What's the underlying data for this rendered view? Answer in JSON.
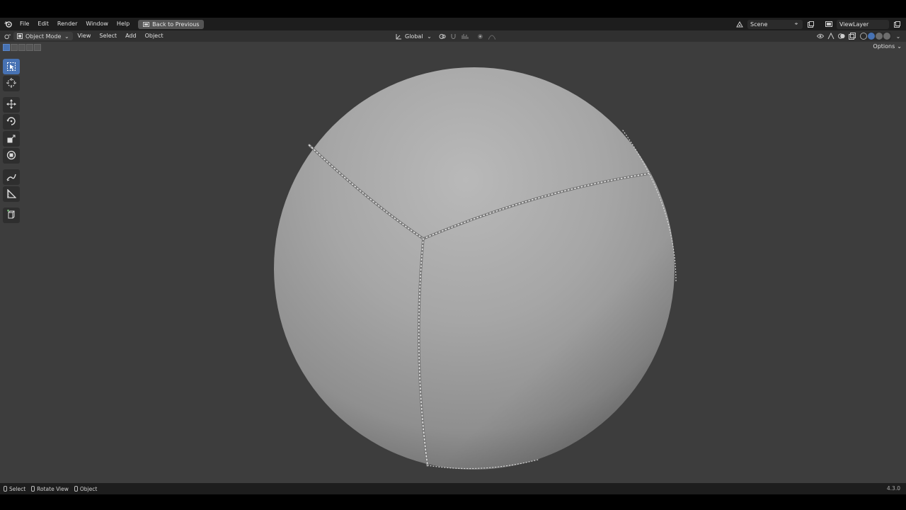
{
  "menubar": {
    "items": [
      "File",
      "Edit",
      "Render",
      "Window",
      "Help"
    ],
    "back_button": "Back to Previous",
    "scene": "Scene",
    "view_layer": "ViewLayer"
  },
  "viewport_header": {
    "mode": "Object Mode",
    "menus": [
      "View",
      "Select",
      "Add",
      "Object"
    ],
    "transform_orientation": "Global",
    "options": "Options"
  },
  "statusbar": {
    "items": [
      "Select",
      "Rotate View",
      "Object"
    ],
    "version": "4.3.0"
  },
  "colors": {
    "accent": "#4772b3",
    "viewport_bg": "#3d3d3d",
    "header_bg": "#303030",
    "topbar_bg": "#1d1d1d"
  }
}
